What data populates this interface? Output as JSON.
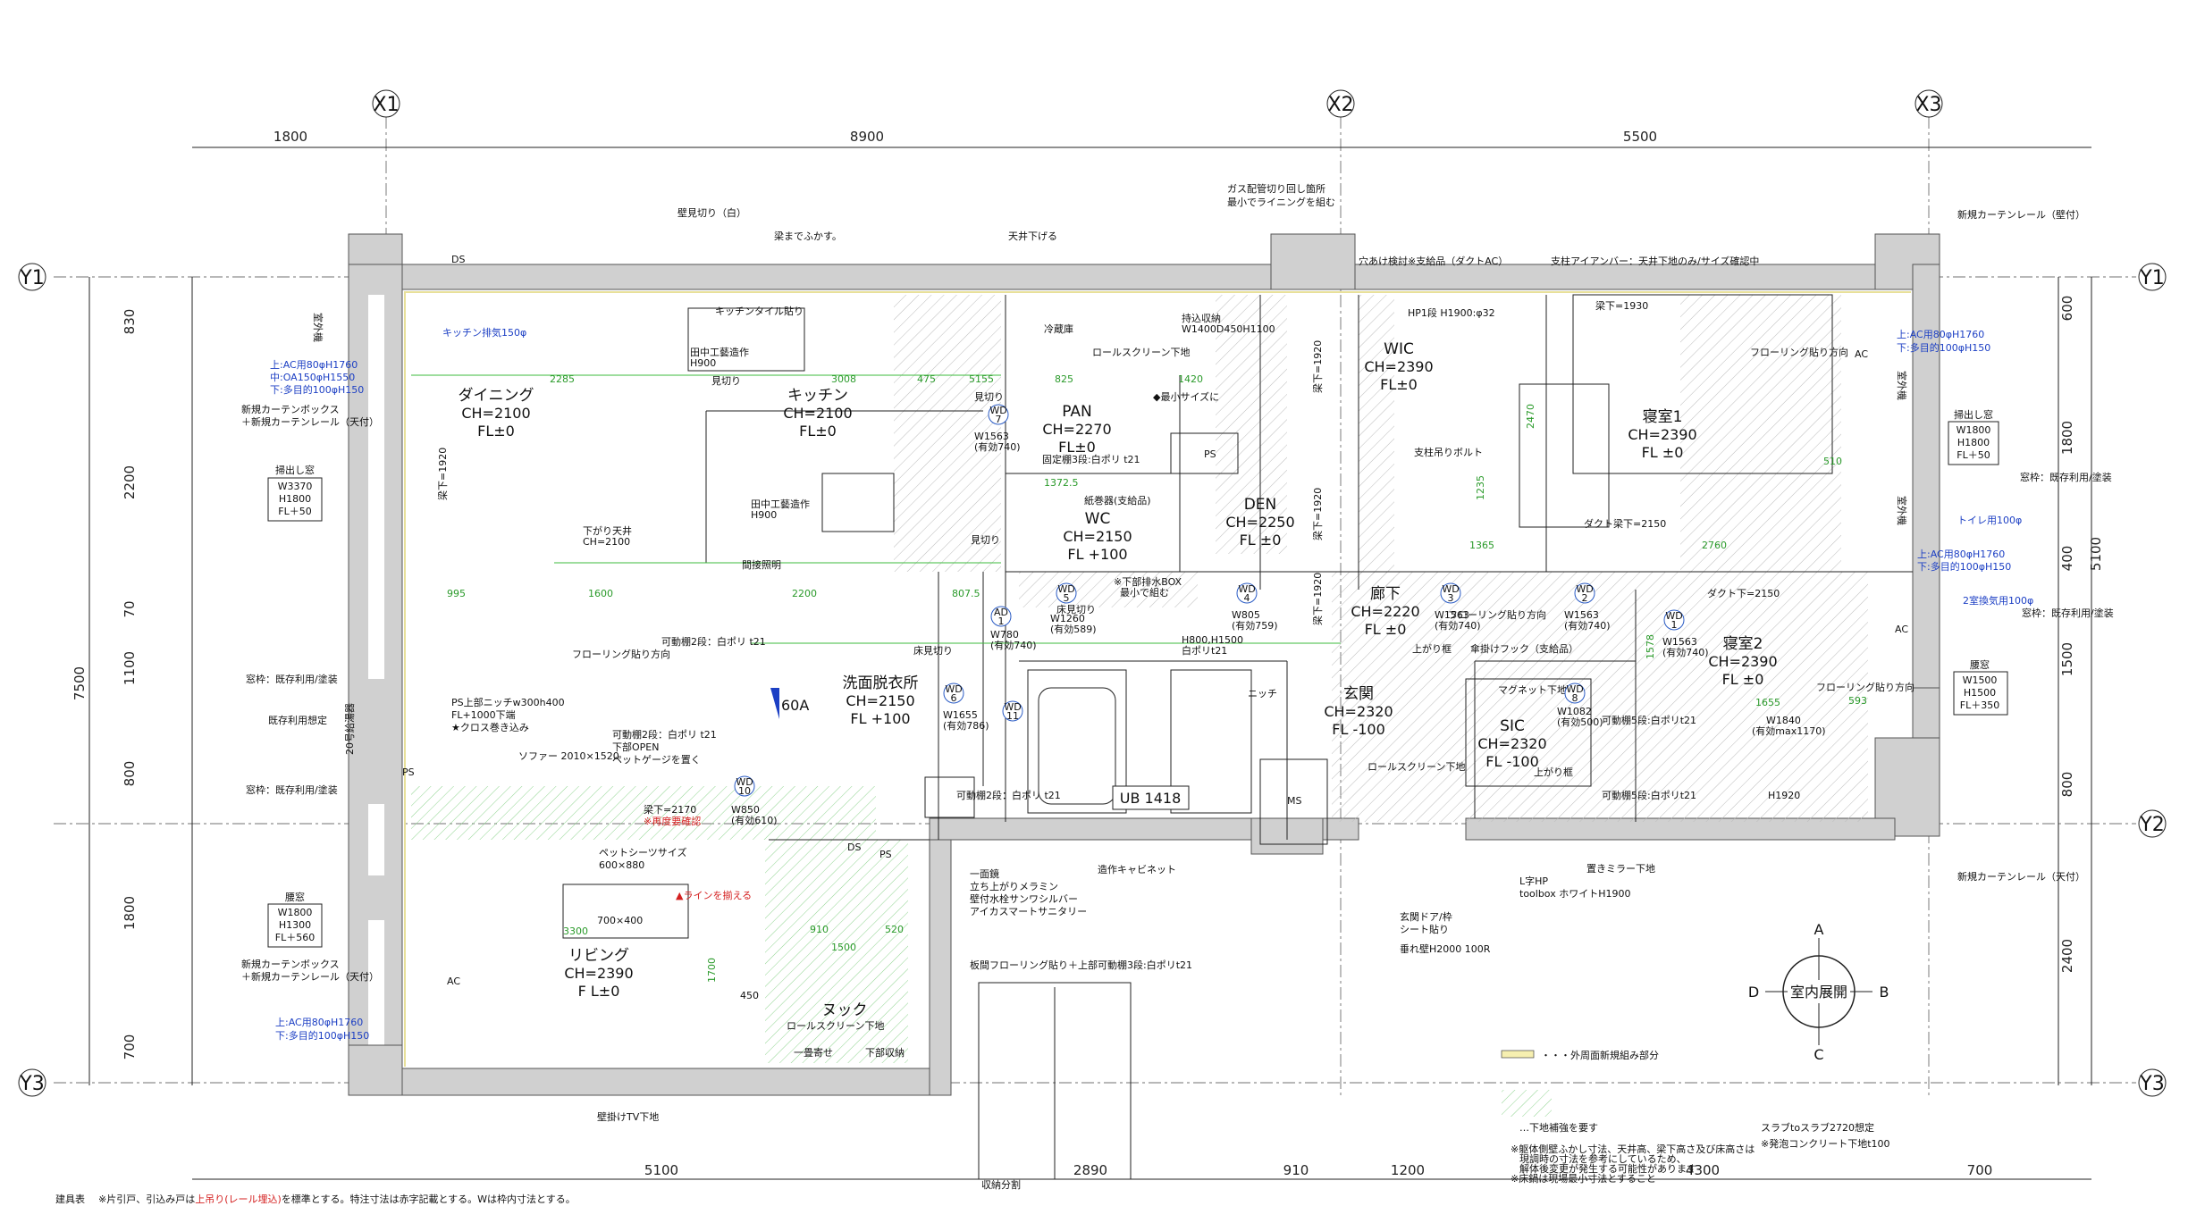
{
  "grid": {
    "x_labels": [
      "X1",
      "X2",
      "X3"
    ],
    "y_labels": [
      "Y1",
      "Y2",
      "Y3"
    ],
    "top_dims": [
      "1800",
      "8900",
      "5500"
    ],
    "bottom_dims": [
      "5100",
      "2890",
      "910",
      "1200",
      "4300",
      "700"
    ],
    "left_dims": [
      "830",
      "2200",
      "70",
      "1100",
      "800",
      "1800",
      "700"
    ],
    "left_total": "7500",
    "right_dims": [
      "600",
      "1800",
      "400",
      "1500",
      "800",
      "2400"
    ],
    "right_total": "5100"
  },
  "rooms": [
    {
      "name": "ダイニング",
      "ch": "CH=2100",
      "fl": "FL±0"
    },
    {
      "name": "キッチン",
      "ch": "CH=2100",
      "fl": "FL±0"
    },
    {
      "name": "PAN",
      "ch": "CH=2270",
      "fl": "FL±0"
    },
    {
      "name": "WC",
      "ch": "CH=2150",
      "fl": "FL +100"
    },
    {
      "name": "DEN",
      "ch": "CH=2250",
      "fl": "FL ±0"
    },
    {
      "name": "WIC",
      "ch": "CH=2390",
      "fl": "FL±0"
    },
    {
      "name": "寝室1",
      "ch": "CH=2390",
      "fl": "FL ±0"
    },
    {
      "name": "廊下",
      "ch": "CH=2220",
      "fl": "FL ±0"
    },
    {
      "name": "寝室2",
      "ch": "CH=2390",
      "fl": "FL ±0"
    },
    {
      "name": "洗面脱衣所",
      "ch": "CH=2150",
      "fl": "FL +100"
    },
    {
      "name": "玄関",
      "ch": "CH=2320",
      "fl": "FL -100"
    },
    {
      "name": "SIC",
      "ch": "CH=2320",
      "fl": "FL -100"
    },
    {
      "name": "リビング",
      "ch": "CH=2390",
      "fl": "F L±0"
    },
    {
      "name": "ヌック",
      "ch": "",
      "fl": ""
    }
  ],
  "windows": [
    {
      "title": "掃出し窓",
      "w": "W3370",
      "h": "H1800",
      "fl": "FL＋50"
    },
    {
      "title": "腰窓",
      "w": "W1800",
      "h": "H1300",
      "fl": "FL＋560"
    },
    {
      "title": "掃出し窓",
      "w": "W1800",
      "h": "H1800",
      "fl": "FL＋50"
    },
    {
      "title": "腰窓",
      "w": "W1500",
      "h": "H1500",
      "fl": "FL＋350"
    }
  ],
  "blue_notes": [
    "キッチン排気150φ",
    "上:AC用80φH1760",
    "中:OA150φH1550",
    "下:多目的100φH150",
    "上:AC用80φH1760",
    "下:多目的100φH150",
    "上:AC用80φH1760",
    "下:多目的100φH150",
    "トイレ用100φ",
    "上:AC用80φH1760",
    "下:多目的100φH150",
    "2室換気用100φ"
  ],
  "notes": {
    "kabemikiri": "壁見切り（白）",
    "harimade": "梁までふかす。",
    "tenjo": "天井下げる",
    "gas": "ガス配管切り回し箇所",
    "gas2": "最小でライニングを組む",
    "ds": "DS",
    "anaake": "穴あけ検討※支給品（ダクトAC）",
    "shien": "支柱アイアンバー：天井下地のみ/サイズ確認中",
    "curtain_wall": "新規カーテンレール（壁付）",
    "curtain_ceiling": "新規カーテンレール（天付）",
    "curtain_box": "新規カーテンボックス",
    "curtain_box2": "＋新規カーテンレール（天付）",
    "madowaku": "窓枠：既存利用/塗装",
    "kizon": "既存利用想定",
    "sofa": "ソファー 2010×1520",
    "pet": "ペットシーツサイズ",
    "pet_size": "600×880",
    "line_red": "▲ラインを揃える",
    "red2": "※再度要確認",
    "ps_niche": "PS上部ニッチw300h400",
    "ps_niche2": "FL+1000下端",
    "ps_niche3": "★クロス巻き込み",
    "kadou": "可動棚2段：白ポリ t21",
    "kadou_open": "下部OPEN",
    "pet_gauge": "ペットゲージを置く",
    "ichimen": "一面鏡",
    "melamine": "立ち上がりメラミン",
    "suisen": "壁付水栓サンワシルバー",
    "aika": "アイカスマートサニタリー",
    "zousaku": "造作キャビネット",
    "itabari": "板間フローリング貼り＋上部可動棚3段:白ポリt21",
    "rollscreen": "ロールスクリーン下地",
    "kabekake_tv": "壁掛けTV下地",
    "ippai": "一畳寄せ",
    "kaishu": "下部収納",
    "genkan_door": "玄関ドア/枠",
    "genkan_door2": "シート貼り",
    "tare": "垂れ壁H2000 100R",
    "lhp": "L字HP",
    "toolbox": "toolbox ホワイトH1900",
    "mirror": "置きミラー下地",
    "kasa": "傘掛けフック（支給品）",
    "mochikomi": "持込収納",
    "mochikomi2": "W1400D450H1100",
    "niche": "ニッチ",
    "flooring": "フローリング貼り方向",
    "ub": "UB 1418",
    "sixty": "60A",
    "legend_new": "・・・外周面新規組み部分",
    "legend_hokyo": "…下地補強を要す",
    "slab": "スラブtoスラブ2720想定",
    "foam": "※発泡コンクリート下地t100",
    "small1": "※躯体側壁ふかし寸法、天井高、梁下高さ及び床高さは",
    "small2": "現調時の寸法を参考にしているため、",
    "small3": "解体後変更が発生する可能性があります",
    "small4": "※床鍋は現場最小寸法とすること",
    "tategu_title": "建具表",
    "tategu_pre": "※片引戸、引込み戸は",
    "tategu_red": "上吊り(レール埋込)",
    "tategu_post": "を標準とする。特注寸法は赤字記載とする。Wは枠内寸法とする。",
    "shuno": "収納分割",
    "ms": "MS",
    "ps": "PS",
    "tanaka": "田中工藝造作",
    "tanaka_h": "H900",
    "kitchen_tile": "キッチンタイル貼り",
    "reizouko": "冷蔵庫",
    "mikiri": "見切り",
    "yuka_mikiri": "床見切り",
    "kansetsu": "間接照明",
    "sagari": "下がり天井",
    "sagari_ch": "CH=2100",
    "hari1920": "梁下=1920",
    "hari2170": "梁下=2170",
    "hari2150": "ダクト梁下=2150",
    "hari1930": "梁下=1930",
    "dakuto": "ダクト下=2150",
    "shichu": "支柱吊りボルト",
    "hp": "HP1段 H1900:φ32",
    "kotei": "固定棚3段:白ポリ t21",
    "kamimaki": "紙巻器(支給品)",
    "haisui": "※下部排水BOX",
    "haisui2": "最小で組む",
    "saisho": "◆最小サイズに",
    "agarikamachi": "上がり框",
    "magnet": "マグネット下地",
    "kadou5": "可動棚5段:白ポリt21",
    "compass_center": "室内展開",
    "compass_a": "A",
    "compass_b": "B",
    "compass_c": "C",
    "compass_d": "D",
    "ac": "AC",
    "shitsugai": "室外機",
    "sealed": "20号給湯器"
  },
  "doors": [
    {
      "id": "WD",
      "n": "7",
      "w": "W1563",
      "yuko": "(有効740)"
    },
    {
      "id": "WD",
      "n": "5",
      "w": "W1260",
      "yuko": "(有効589)"
    },
    {
      "id": "WD",
      "n": "4",
      "w": "W805",
      "yuko": "(有効759)"
    },
    {
      "id": "AD",
      "n": "1",
      "w": "W780",
      "yuko": "(有効740)"
    },
    {
      "id": "WD",
      "n": "3",
      "w": "W1563",
      "yuko": "(有効740)"
    },
    {
      "id": "WD",
      "n": "2",
      "w": "W1563",
      "yuko": "(有効740)"
    },
    {
      "id": "WD",
      "n": "1",
      "w": "W1563",
      "yuko": "(有効740)"
    },
    {
      "id": "WD",
      "n": "6",
      "w": "W1655",
      "yuko": "(有効786)"
    },
    {
      "id": "WD",
      "n": "11",
      "w": "",
      "yuko": ""
    },
    {
      "id": "WD",
      "n": "8",
      "w": "W1082",
      "yuko": "(有効500)"
    },
    {
      "id": "WD",
      "n": "10",
      "w": "W850",
      "yuko": "(有効610)"
    }
  ],
  "inner_dims": [
    "2285",
    "3008",
    "475",
    "5155",
    "825",
    "1420",
    "995",
    "1600",
    "2200",
    "807.5",
    "1372.5",
    "1365",
    "2760",
    "1655",
    "W1840",
    "(有効max1170)",
    "H800,H1500",
    "白ポリt21",
    "3300",
    "700×400",
    "910",
    "520",
    "1500",
    "1700",
    "450",
    "2470",
    "1235",
    "1578",
    "593",
    "510",
    "H1920"
  ],
  "colors": {
    "wall": "#d0d0d0",
    "green": "#3dbb3d",
    "blue": "#1c3fc4",
    "red": "#d42020",
    "line": "#222222"
  }
}
